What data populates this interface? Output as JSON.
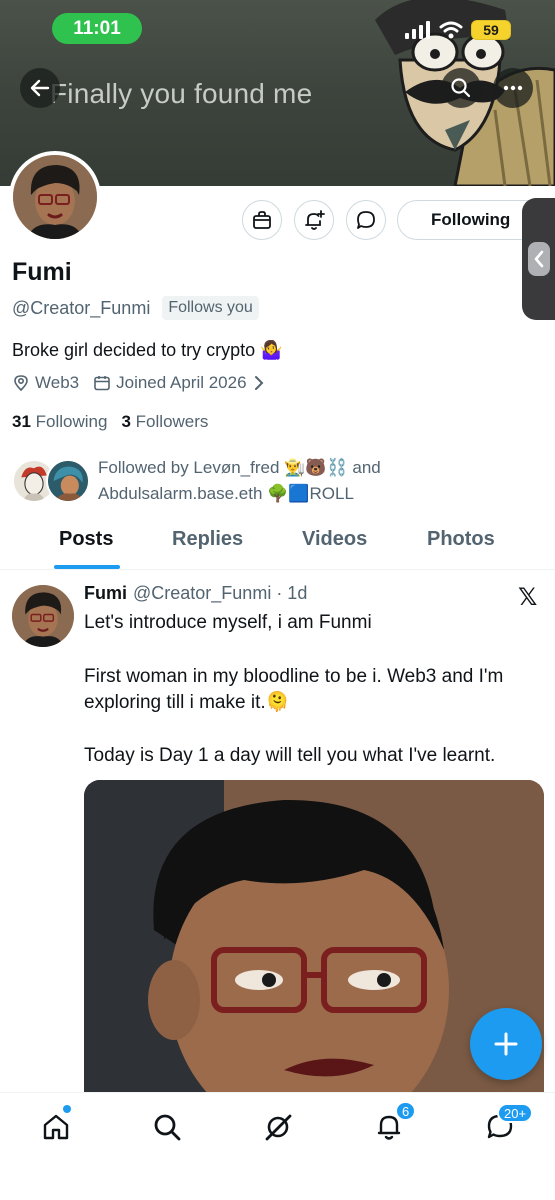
{
  "status_bar": {
    "time": "11:01",
    "battery": "59"
  },
  "banner": {
    "text": "Finally you found me"
  },
  "profile": {
    "name": "Fumi",
    "handle": "@Creator_Funmi",
    "follows_you": "Follows you",
    "bio": "Broke girl decided to try crypto 🤷‍♀️",
    "location": "Web3",
    "joined": "Joined April 2026",
    "following_count": "31",
    "following_label": "Following",
    "followers_count": "3",
    "followers_label": "Followers",
    "followed_by_line1": "Followed by Levøn_fred 👨‍🌾🐻⛓️ and",
    "followed_by_line2": "Abdulsalarm.base.eth 🌳🟦ROLL",
    "follow_button": "Following"
  },
  "tabs": [
    "Posts",
    "Replies",
    "Videos",
    "Photos"
  ],
  "post": {
    "name": "Fumi",
    "handle_time": "@Creator_Funmi · 1d",
    "logo": "𝕏",
    "line1": "Let's introduce myself,  i am Funmi",
    "line2": "First woman in my bloodline to be i. Web3 and I'm",
    "line3": "exploring till i make it.🫠",
    "line4": "Today is Day 1 a day will tell you what I've learnt."
  },
  "bottom_nav": {
    "notifications_badge": "6",
    "messages_badge": "20+"
  },
  "colors": {
    "accent": "#1d9bf0",
    "status_green": "#2fc24e",
    "battery_yellow": "#f6d22c"
  }
}
